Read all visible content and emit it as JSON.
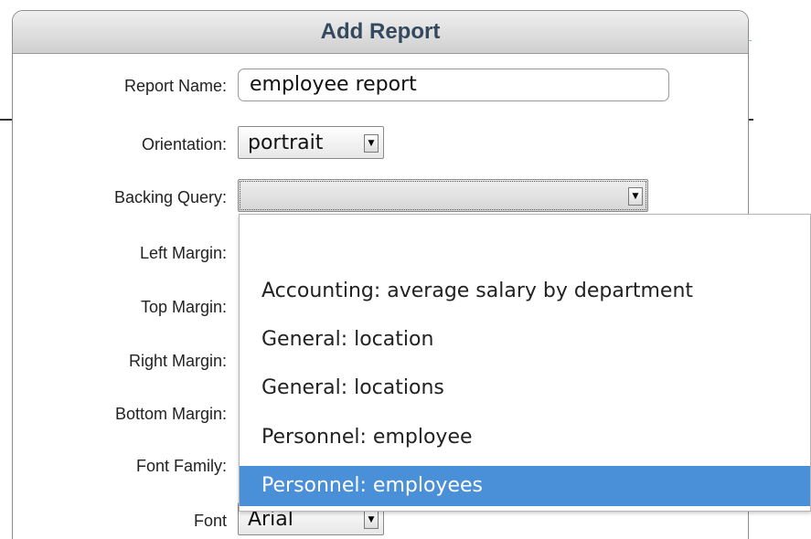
{
  "dialog": {
    "title": "Add Report"
  },
  "form": {
    "report_name": {
      "label": "Report Name:",
      "value": "employee report"
    },
    "orientation": {
      "label": "Orientation:",
      "value": "portrait"
    },
    "backing_query": {
      "label": "Backing Query:",
      "value": ""
    },
    "left_margin": {
      "label": "Left Margin:"
    },
    "top_margin": {
      "label": "Top Margin:"
    },
    "right_margin": {
      "label": "Right Margin:"
    },
    "bottom_margin": {
      "label": "Bottom Margin:"
    },
    "font_family": {
      "label": "Font Family:"
    },
    "font": {
      "label": "Font",
      "value": "Arial"
    }
  },
  "dropdown": {
    "options": [
      "",
      "Accounting: average salary by department",
      "General: location",
      "General: locations",
      "Personnel: employee",
      "Personnel: employees"
    ],
    "highlighted": "Personnel: employees",
    "highlight_color": "#4a90d9"
  },
  "colors": {
    "title_text": "#34495e"
  },
  "icons": {
    "select_arrow": "chevron-down-icon"
  }
}
